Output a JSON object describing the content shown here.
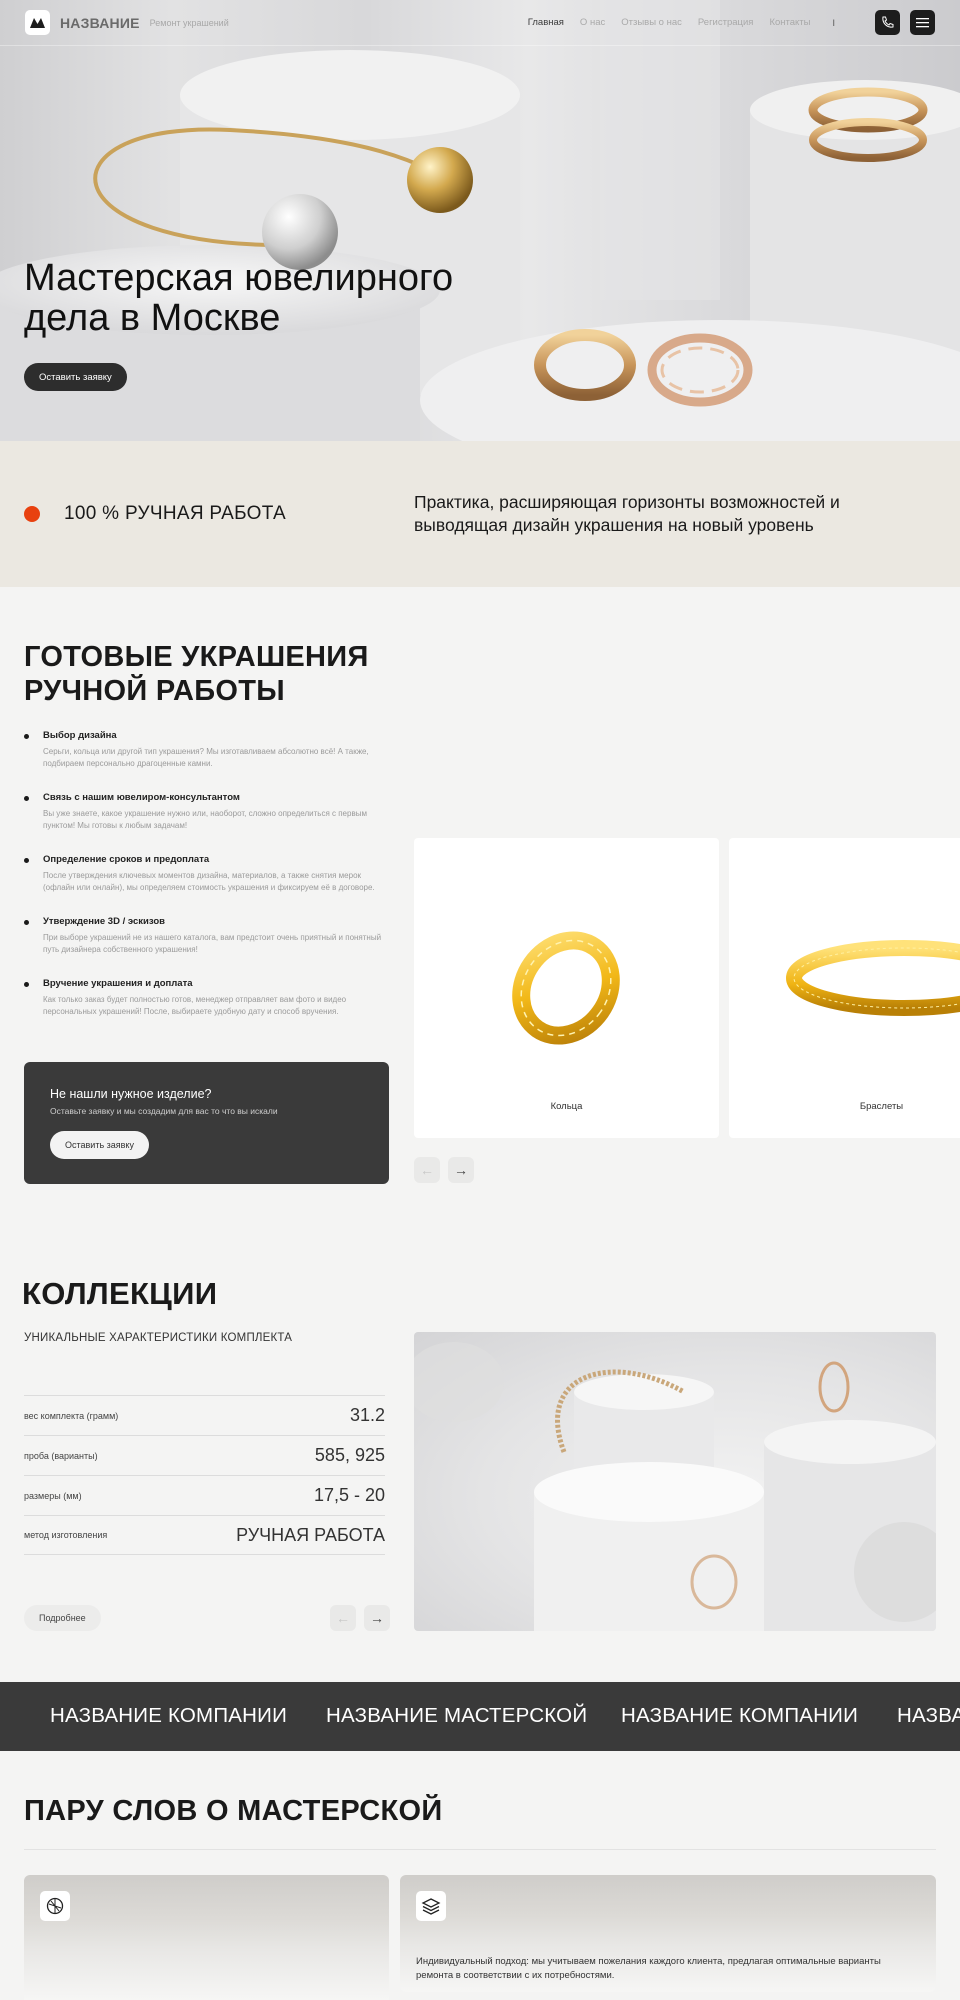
{
  "header": {
    "brand": "НАЗВАНИЕ",
    "tagline": "Ремонт украшений",
    "nav": [
      "Главная",
      "О нас",
      "Отзывы о нас",
      "Регистрация",
      "Контакты"
    ],
    "lang_indicator": "I",
    "phone_icon": "phone-icon",
    "menu_icon": "menu-icon"
  },
  "hero": {
    "title": "Мастерская ювелирного дела в Москве",
    "button": "Оставить заявку"
  },
  "feature_band": {
    "accent_color": "#e8410f",
    "handmade": "100 % РУЧНАЯ РАБОТА",
    "practice": "Практика, расширяющая горизонты возможностей и выводящая дизайн украшения на новый уровень"
  },
  "ready": {
    "title": "ГОТОВЫЕ УКРАШЕНИЯ РУЧНОЙ РАБОТЫ",
    "steps": [
      {
        "title": "Выбор дизайна",
        "desc": "Серьги, кольца или другой тип украшения? Мы изготавливаем абсолютно всё! А также, подбираем персонально драгоценные камни."
      },
      {
        "title": "Связь с нашим ювелиром-консультантом",
        "desc": "Вы уже знаете, какое украшение нужно или, наоборот, сложно определиться с первым пунктом! Мы готовы к любым задачам!"
      },
      {
        "title": "Определение сроков и предоплата",
        "desc": "После утверждения ключевых моментов дизайна, материалов, а также снятия мерок (офлайн или онлайн), мы определяем стоимость украшения и фиксируем её в договоре."
      },
      {
        "title": "Утверждение 3D / эскизов",
        "desc": "При выборе украшений не из нашего каталога, вам предстоит очень приятный и понятный путь дизайнера собственного украшения!"
      },
      {
        "title": "Вручение украшения и доплата",
        "desc": "Как только заказ будет полностью готов, менеджер отправляет вам фото и видео персональных украшений! После, выбираете удобную дату и способ вручения."
      }
    ],
    "cta": {
      "title": "Не нашли нужное  изделие?",
      "desc": "Оставьте заявку и мы создадим для вас то что вы искали",
      "button": "Оставить заявку"
    },
    "cards": [
      {
        "label": "Кольца",
        "icon": "gold-ring-image"
      },
      {
        "label": "Браслеты",
        "icon": "gold-bracelet-image"
      }
    ],
    "prev_arrow": "←",
    "next_arrow": "→"
  },
  "collections": {
    "title": "КОЛЛЕКЦИИ",
    "subtitle": "УНИКАЛЬНЫЕ ХАРАКТЕРИСТИКИ КОМПЛЕКТА",
    "specs": [
      {
        "label": "вес комплекта (грамм)",
        "value": "31.2"
      },
      {
        "label": "проба (варианты)",
        "value": "585, 925"
      },
      {
        "label": "размеры (мм)",
        "value": "17,5 - 20"
      },
      {
        "label": "метод изготовления",
        "value": "РУЧНАЯ РАБОТА"
      }
    ],
    "more_button": "Подробнее",
    "prev_arrow": "←",
    "next_arrow": "→"
  },
  "marquee": [
    "НАЗВАНИЕ КОМПАНИИ",
    "НАЗВАНИЕ МАСТЕРСКОЙ",
    "НАЗВАНИЕ КОМПАНИИ",
    "НАЗВА"
  ],
  "about": {
    "title": "ПАРУ СЛОВ О МАСТЕРСКОЙ",
    "card2_text": "Индивидуальный подход: мы учитываем пожелания каждого клиента, предлагая оптимальные варианты ремонта в соответствии с их потребностями."
  }
}
